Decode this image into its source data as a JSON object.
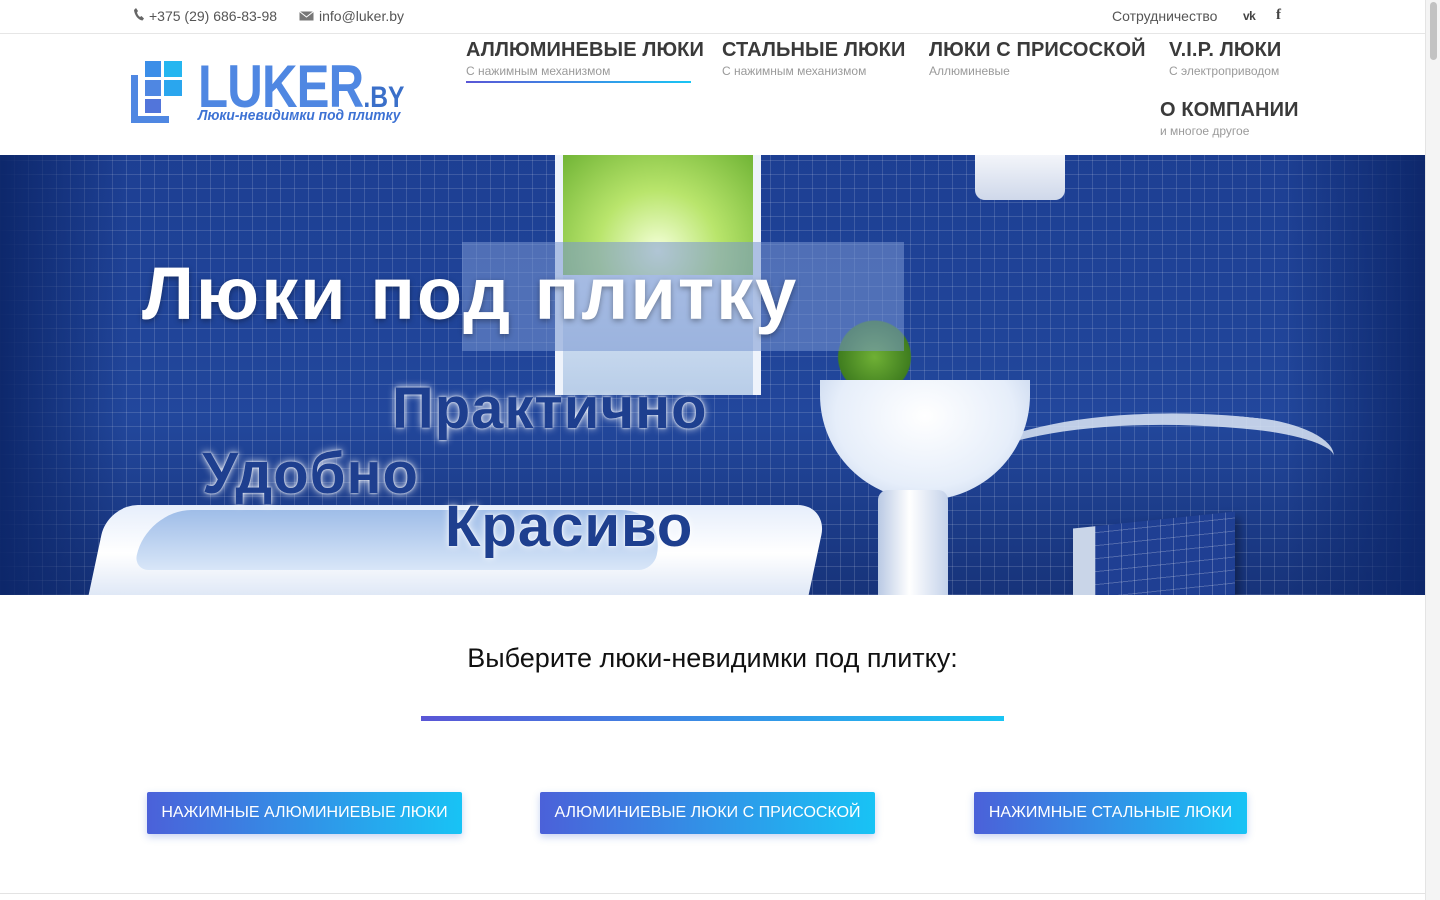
{
  "topbar": {
    "phone": "+375 (29) 686-83-98",
    "email": "info@luker.by",
    "cooperation": "Сотрудничество",
    "vk_label": "vk",
    "fb_label": "f"
  },
  "logo": {
    "brand": "LUKER",
    "tld": ".BY",
    "slogan": "Люки-невидимки под плитку"
  },
  "nav": [
    {
      "title": "АЛЛЮМИНЕВЫЕ ЛЮКИ",
      "subtitle": "С нажимным механизмом",
      "active": true
    },
    {
      "title": "СТАЛЬНЫЕ ЛЮКИ",
      "subtitle": "С нажимным механизмом"
    },
    {
      "title": "ЛЮКИ С ПРИСОСКОЙ",
      "subtitle": "Аллюминевые"
    },
    {
      "title": "V.I.P. ЛЮКИ",
      "subtitle": "С электроприводом"
    },
    {
      "title": "О КОМПАНИИ",
      "subtitle": "и многое другое"
    }
  ],
  "hero": {
    "headline": "Люки под плитку",
    "words": [
      "Практично",
      "Удобно",
      "Красиво"
    ]
  },
  "section": {
    "title": "Выберите люки-невидимки под плитку:"
  },
  "buttons": [
    "Нажимные алюминиевые люки",
    "Алюминиевые люки с присоской",
    "Нажимные стальные люки"
  ],
  "colors": {
    "accent_start": "#5a56d6",
    "accent_end": "#19c5f4",
    "logo_blue": "#4f87e2",
    "hero_blue": "#1e3f8f"
  },
  "icons": {
    "phone": "phone-icon",
    "email": "envelope-icon",
    "vk": "vk-icon",
    "facebook": "facebook-icon"
  }
}
